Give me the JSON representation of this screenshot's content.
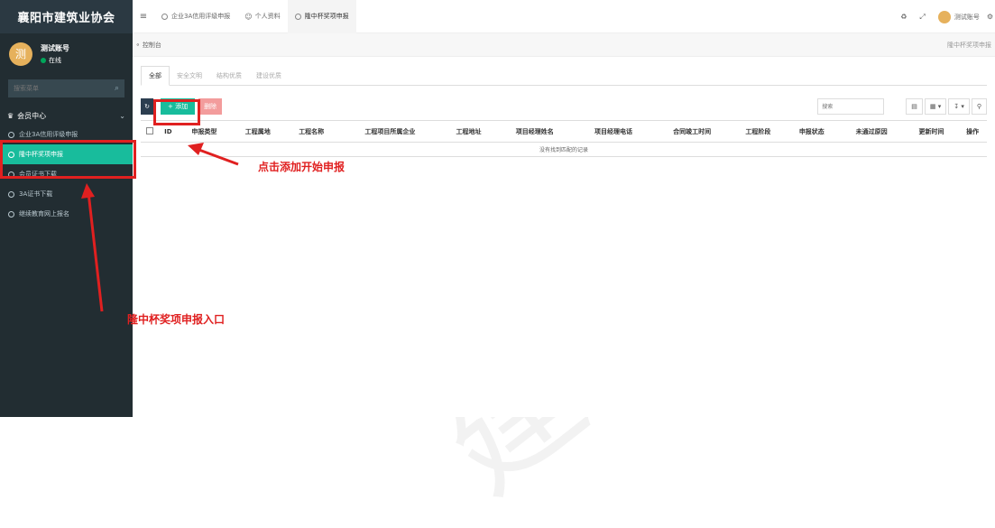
{
  "sidebar": {
    "brand": "襄阳市建筑业协会",
    "user": {
      "avatar": "测",
      "name": "测试账号",
      "status": "在线"
    },
    "search_placeholder": "搜索菜单",
    "group_label": "会员中心",
    "items": [
      {
        "label": "企业3A信用评级申报"
      },
      {
        "label": "隆中杯奖项申报"
      },
      {
        "label": "会员证书下载"
      },
      {
        "label": "3A证书下载"
      },
      {
        "label": "继续教育网上报名"
      }
    ]
  },
  "topbar": {
    "tabs": [
      {
        "label": "企业3A信用评级申报"
      },
      {
        "label": "个人资料"
      },
      {
        "label": "隆中杯奖项申报"
      }
    ],
    "user_label": "测试账号"
  },
  "breadcrumb": {
    "left": "控制台",
    "right": "隆中杯奖项申报"
  },
  "subtabs": [
    "全部",
    "安全文明",
    "结构优质",
    "建设优质"
  ],
  "toolbar": {
    "add_label": "+ 添加",
    "delete_label": "删除",
    "search_placeholder": "搜索"
  },
  "table": {
    "headers": [
      "ID",
      "申报类型",
      "工程属地",
      "工程名称",
      "工程项目所属企业",
      "工程地址",
      "项目经理姓名",
      "项目经理电话",
      "合同竣工时间",
      "工程阶段",
      "申报状态",
      "未通过原因",
      "更新时间",
      "操作"
    ],
    "empty_text": "没有找到匹配的记录"
  },
  "annotations": {
    "add_hint": "点击添加开始申报",
    "entry_hint": "隆中杯奖项申报入口",
    "color": "#e02020"
  },
  "watermark": "建筑业协会"
}
